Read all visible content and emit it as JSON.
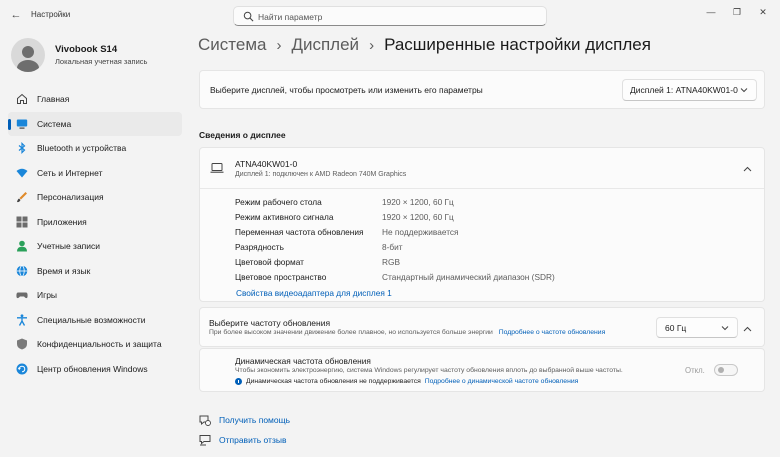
{
  "window": {
    "title": "Настройки",
    "back_glyph": "←",
    "minimize_glyph": "—",
    "maximize_glyph": "❐",
    "close_glyph": "✕"
  },
  "search": {
    "placeholder": "Найти параметр"
  },
  "profile": {
    "name": "Vivobook S14",
    "account_type": "Локальная учетная запись"
  },
  "sidebar": {
    "items": [
      {
        "label": "Главная",
        "icon": "home-icon"
      },
      {
        "label": "Система",
        "icon": "system-icon",
        "active": true
      },
      {
        "label": "Bluetooth и устройства",
        "icon": "bluetooth-icon"
      },
      {
        "label": "Сеть и Интернет",
        "icon": "network-icon"
      },
      {
        "label": "Персонализация",
        "icon": "personalization-icon"
      },
      {
        "label": "Приложения",
        "icon": "apps-icon"
      },
      {
        "label": "Учетные записи",
        "icon": "accounts-icon"
      },
      {
        "label": "Время и язык",
        "icon": "globe-icon"
      },
      {
        "label": "Игры",
        "icon": "gaming-icon"
      },
      {
        "label": "Специальные возможности",
        "icon": "accessibility-icon"
      },
      {
        "label": "Конфиденциальность и защита",
        "icon": "shield-icon"
      },
      {
        "label": "Центр обновления Windows",
        "icon": "update-icon"
      }
    ]
  },
  "breadcrumb": {
    "items": [
      "Система",
      "Дисплей",
      "Расширенные настройки дисплея"
    ],
    "separator": "›"
  },
  "display_select": {
    "label": "Выберите дисплей, чтобы просмотреть или изменить его параметры",
    "value": "Дисплей 1: ATNA40KW01-0"
  },
  "display_info": {
    "section_title": "Сведения о дисплее",
    "monitor_name": "ATNA40KW01-0",
    "monitor_sub": "Дисплей 1: подключен к AMD Radeon 740M Graphics",
    "specs": [
      {
        "label": "Режим рабочего стола",
        "value": "1920 × 1200, 60 Гц"
      },
      {
        "label": "Режим активного сигнала",
        "value": "1920 × 1200, 60 Гц"
      },
      {
        "label": "Переменная частота обновления",
        "value": "Не поддерживается"
      },
      {
        "label": "Разрядность",
        "value": "8-бит"
      },
      {
        "label": "Цветовой формат",
        "value": "RGB"
      },
      {
        "label": "Цветовое пространство",
        "value": "Стандартный динамический диапазон (SDR)"
      }
    ],
    "adapter_link": "Свойства видеоадаптера для дисплея 1"
  },
  "refresh_rate": {
    "title": "Выберите частоту обновления",
    "description": "При более высоком значении движение более плавное, но используется больше энергии",
    "link": "Подробнее о частоте обновления",
    "value": "60 Гц"
  },
  "dynamic_refresh": {
    "title": "Динамическая частота обновления",
    "description": "Чтобы экономить электроэнергию, система Windows регулирует частоту обновления вплоть до выбранной выше частоты.",
    "warning": "Динамическая частота обновления не поддерживается",
    "link": "Подробнее о динамической частоте обновления",
    "toggle_label": "Откл.",
    "toggle_on": false
  },
  "footer": {
    "help": "Получить помощь",
    "feedback": "Отправить отзыв"
  },
  "colors": {
    "accent": "#005fb8",
    "background": "#f3f3f3",
    "card": "#fbfbfb"
  }
}
